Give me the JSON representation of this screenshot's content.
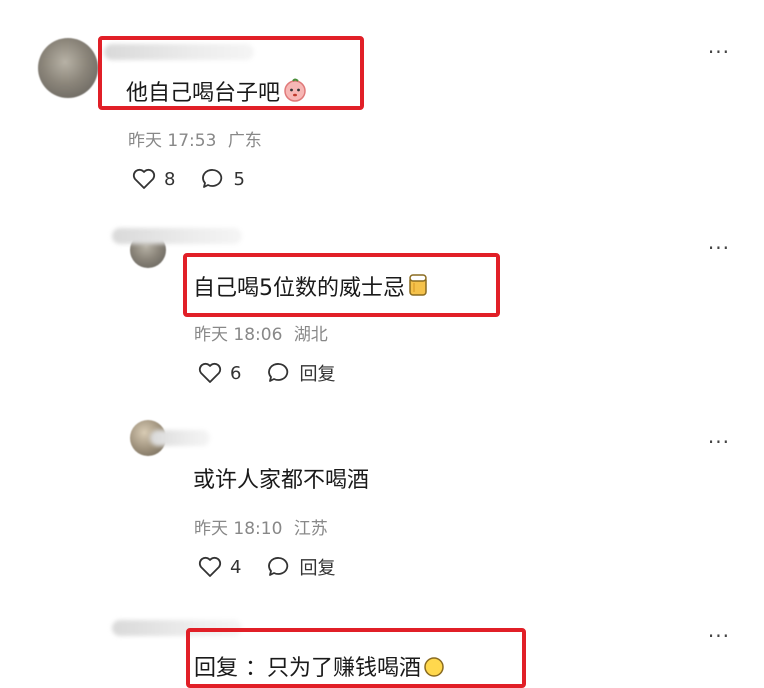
{
  "comments": [
    {
      "text": "他自己喝台子吧",
      "emoji_icon": "peach-face-icon",
      "time": "昨天 17:53",
      "location": "广东",
      "likes": "8",
      "replies": "5"
    },
    {
      "text": "自己喝5位数的威士忌",
      "emoji_icon": "beer-mug-icon",
      "time": "昨天 18:06",
      "location": "湖北",
      "likes": "6",
      "reply_label": "回复"
    },
    {
      "text": "或许人家都不喝酒",
      "time": "昨天 18:10",
      "location": "江苏",
      "likes": "4",
      "reply_label": "回复"
    },
    {
      "text": "回复  ：只为了赚钱喝酒",
      "emoji_icon": "smile-face-icon"
    }
  ],
  "more_label": "...",
  "highlight_color": "#e11f27"
}
